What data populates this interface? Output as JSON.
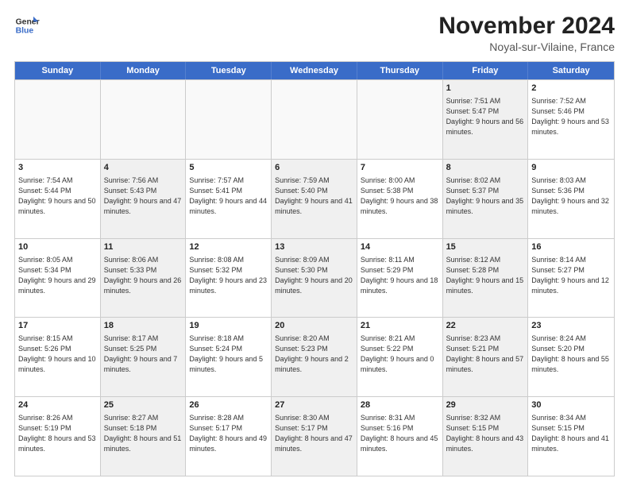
{
  "logo": {
    "line1": "General",
    "line2": "Blue"
  },
  "title": "November 2024",
  "location": "Noyal-sur-Vilaine, France",
  "days_of_week": [
    "Sunday",
    "Monday",
    "Tuesday",
    "Wednesday",
    "Thursday",
    "Friday",
    "Saturday"
  ],
  "rows": [
    [
      {
        "day": "",
        "info": "",
        "empty": true
      },
      {
        "day": "",
        "info": "",
        "empty": true
      },
      {
        "day": "",
        "info": "",
        "empty": true
      },
      {
        "day": "",
        "info": "",
        "empty": true
      },
      {
        "day": "",
        "info": "",
        "empty": true
      },
      {
        "day": "1",
        "info": "Sunrise: 7:51 AM\nSunset: 5:47 PM\nDaylight: 9 hours and 56 minutes.",
        "shaded": true
      },
      {
        "day": "2",
        "info": "Sunrise: 7:52 AM\nSunset: 5:46 PM\nDaylight: 9 hours and 53 minutes.",
        "shaded": false
      }
    ],
    [
      {
        "day": "3",
        "info": "Sunrise: 7:54 AM\nSunset: 5:44 PM\nDaylight: 9 hours and 50 minutes.",
        "shaded": false
      },
      {
        "day": "4",
        "info": "Sunrise: 7:56 AM\nSunset: 5:43 PM\nDaylight: 9 hours and 47 minutes.",
        "shaded": true
      },
      {
        "day": "5",
        "info": "Sunrise: 7:57 AM\nSunset: 5:41 PM\nDaylight: 9 hours and 44 minutes.",
        "shaded": false
      },
      {
        "day": "6",
        "info": "Sunrise: 7:59 AM\nSunset: 5:40 PM\nDaylight: 9 hours and 41 minutes.",
        "shaded": true
      },
      {
        "day": "7",
        "info": "Sunrise: 8:00 AM\nSunset: 5:38 PM\nDaylight: 9 hours and 38 minutes.",
        "shaded": false
      },
      {
        "day": "8",
        "info": "Sunrise: 8:02 AM\nSunset: 5:37 PM\nDaylight: 9 hours and 35 minutes.",
        "shaded": true
      },
      {
        "day": "9",
        "info": "Sunrise: 8:03 AM\nSunset: 5:36 PM\nDaylight: 9 hours and 32 minutes.",
        "shaded": false
      }
    ],
    [
      {
        "day": "10",
        "info": "Sunrise: 8:05 AM\nSunset: 5:34 PM\nDaylight: 9 hours and 29 minutes.",
        "shaded": false
      },
      {
        "day": "11",
        "info": "Sunrise: 8:06 AM\nSunset: 5:33 PM\nDaylight: 9 hours and 26 minutes.",
        "shaded": true
      },
      {
        "day": "12",
        "info": "Sunrise: 8:08 AM\nSunset: 5:32 PM\nDaylight: 9 hours and 23 minutes.",
        "shaded": false
      },
      {
        "day": "13",
        "info": "Sunrise: 8:09 AM\nSunset: 5:30 PM\nDaylight: 9 hours and 20 minutes.",
        "shaded": true
      },
      {
        "day": "14",
        "info": "Sunrise: 8:11 AM\nSunset: 5:29 PM\nDaylight: 9 hours and 18 minutes.",
        "shaded": false
      },
      {
        "day": "15",
        "info": "Sunrise: 8:12 AM\nSunset: 5:28 PM\nDaylight: 9 hours and 15 minutes.",
        "shaded": true
      },
      {
        "day": "16",
        "info": "Sunrise: 8:14 AM\nSunset: 5:27 PM\nDaylight: 9 hours and 12 minutes.",
        "shaded": false
      }
    ],
    [
      {
        "day": "17",
        "info": "Sunrise: 8:15 AM\nSunset: 5:26 PM\nDaylight: 9 hours and 10 minutes.",
        "shaded": false
      },
      {
        "day": "18",
        "info": "Sunrise: 8:17 AM\nSunset: 5:25 PM\nDaylight: 9 hours and 7 minutes.",
        "shaded": true
      },
      {
        "day": "19",
        "info": "Sunrise: 8:18 AM\nSunset: 5:24 PM\nDaylight: 9 hours and 5 minutes.",
        "shaded": false
      },
      {
        "day": "20",
        "info": "Sunrise: 8:20 AM\nSunset: 5:23 PM\nDaylight: 9 hours and 2 minutes.",
        "shaded": true
      },
      {
        "day": "21",
        "info": "Sunrise: 8:21 AM\nSunset: 5:22 PM\nDaylight: 9 hours and 0 minutes.",
        "shaded": false
      },
      {
        "day": "22",
        "info": "Sunrise: 8:23 AM\nSunset: 5:21 PM\nDaylight: 8 hours and 57 minutes.",
        "shaded": true
      },
      {
        "day": "23",
        "info": "Sunrise: 8:24 AM\nSunset: 5:20 PM\nDaylight: 8 hours and 55 minutes.",
        "shaded": false
      }
    ],
    [
      {
        "day": "24",
        "info": "Sunrise: 8:26 AM\nSunset: 5:19 PM\nDaylight: 8 hours and 53 minutes.",
        "shaded": false
      },
      {
        "day": "25",
        "info": "Sunrise: 8:27 AM\nSunset: 5:18 PM\nDaylight: 8 hours and 51 minutes.",
        "shaded": true
      },
      {
        "day": "26",
        "info": "Sunrise: 8:28 AM\nSunset: 5:17 PM\nDaylight: 8 hours and 49 minutes.",
        "shaded": false
      },
      {
        "day": "27",
        "info": "Sunrise: 8:30 AM\nSunset: 5:17 PM\nDaylight: 8 hours and 47 minutes.",
        "shaded": true
      },
      {
        "day": "28",
        "info": "Sunrise: 8:31 AM\nSunset: 5:16 PM\nDaylight: 8 hours and 45 minutes.",
        "shaded": false
      },
      {
        "day": "29",
        "info": "Sunrise: 8:32 AM\nSunset: 5:15 PM\nDaylight: 8 hours and 43 minutes.",
        "shaded": true
      },
      {
        "day": "30",
        "info": "Sunrise: 8:34 AM\nSunset: 5:15 PM\nDaylight: 8 hours and 41 minutes.",
        "shaded": false
      }
    ]
  ]
}
